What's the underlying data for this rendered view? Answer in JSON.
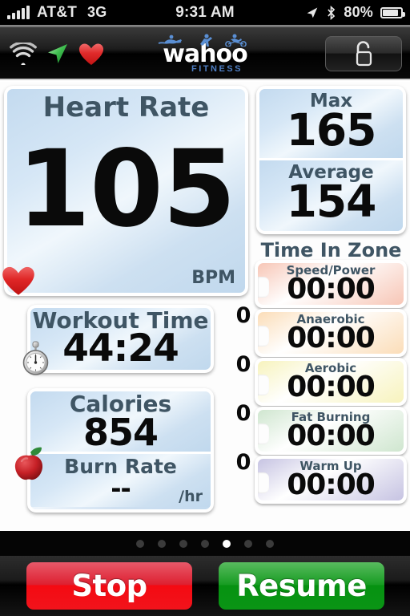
{
  "status_bar": {
    "carrier": "AT&T",
    "network": "3G",
    "time": "9:31 AM",
    "battery_percent": "80%",
    "signal_icon": "signal-bars-icon",
    "location_icon": "location-arrow-icon",
    "bluetooth_icon": "bluetooth-icon",
    "battery_icon": "battery-icon"
  },
  "header": {
    "wifi_icon": "wifi-icon",
    "gps_icon": "location-arrow-icon",
    "heart_icon": "heart-icon",
    "logo_word": "wahoo",
    "logo_sub": "FITNESS",
    "lock_icon": "unlock-icon"
  },
  "heart_rate": {
    "label": "Heart Rate",
    "value": "105",
    "unit": "BPM",
    "badge_icon": "heart-icon"
  },
  "max_avg": {
    "max_label": "Max",
    "max_value": "165",
    "avg_label": "Average",
    "avg_value": "154"
  },
  "workout_time": {
    "label": "Workout Time",
    "value": "44:24",
    "badge_icon": "stopwatch-icon"
  },
  "calories": {
    "label": "Calories",
    "value": "854",
    "burn_rate_label": "Burn Rate",
    "burn_rate_value": "--",
    "burn_rate_unit": "/hr",
    "badge_icon": "apple-icon"
  },
  "time_in_zone": {
    "title": "Time In Zone",
    "zones": [
      {
        "label": "Speed/Power",
        "value": "00:00",
        "color": "#f7c6b6"
      },
      {
        "label": "Anaerobic",
        "value": "00:00",
        "color": "#fbddb8"
      },
      {
        "label": "Aerobic",
        "value": "00:00",
        "color": "#f7f3bd"
      },
      {
        "label": "Fat Burning",
        "value": "00:00",
        "color": "#cfe6cf"
      },
      {
        "label": "Warm Up",
        "value": "00:00",
        "color": "#c6c3e2"
      }
    ],
    "boundaries": [
      "0",
      "0",
      "0",
      "0"
    ]
  },
  "pager": {
    "total": 7,
    "active_index": 4
  },
  "toolbar": {
    "stop_label": "Stop",
    "resume_label": "Resume",
    "stop_color": "#f2131b",
    "resume_color": "#0a9515"
  }
}
